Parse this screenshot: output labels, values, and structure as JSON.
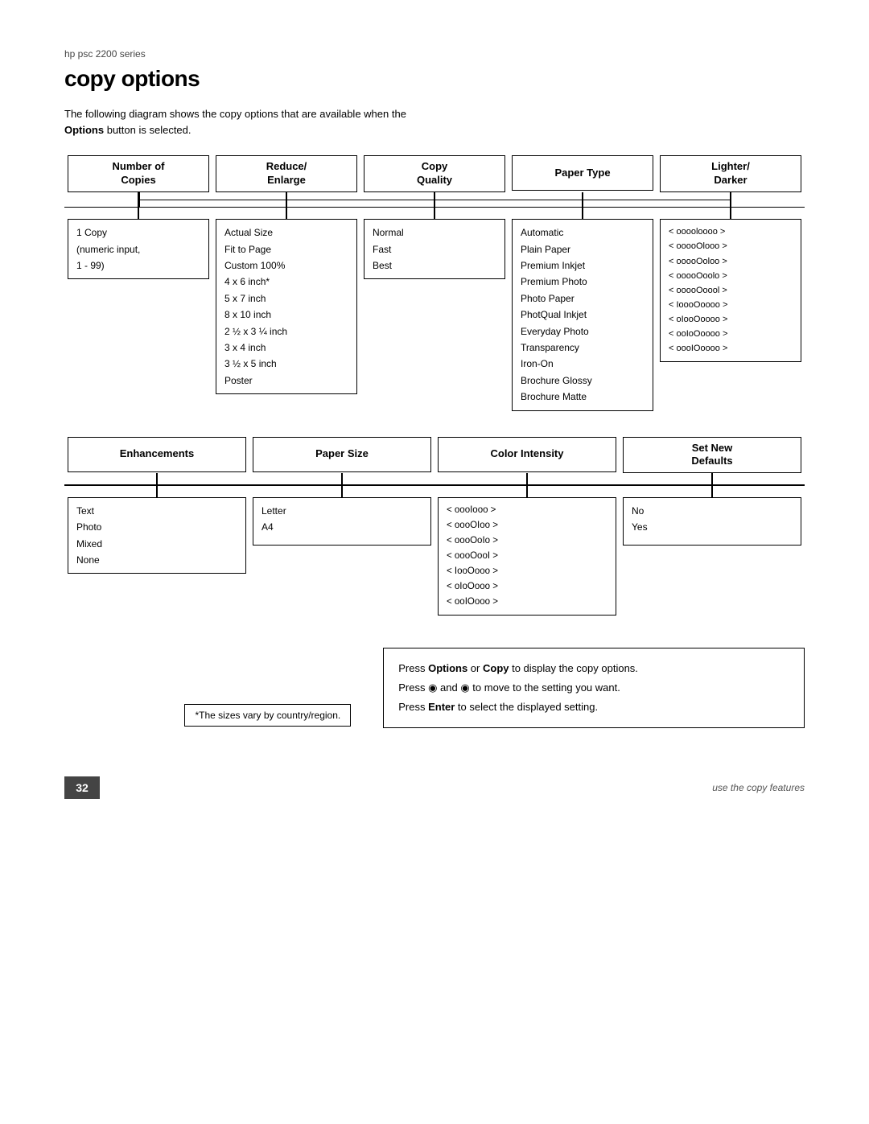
{
  "series": "hp psc 2200 series",
  "title": "copy options",
  "intro": {
    "line1": "The following diagram shows the copy options that are available when the",
    "line2_bold": "Options",
    "line2_rest": " button is selected."
  },
  "row1": {
    "connector_line_height": 18,
    "columns": [
      {
        "id": "number-of-copies",
        "header": "Number of\nCopies",
        "content": "1 Copy\n(numeric input,\n1 - 99)"
      },
      {
        "id": "reduce-enlarge",
        "header": "Reduce/\nEnlarge",
        "content": "Actual Size\nFit to Page\nCustom 100%\n4 x 6 inch*\n5 x 7 inch\n8 x 10 inch\n2 ½ x 3 ¼ inch\n3 x 4 inch\n3 ½ x 5 inch\nPoster"
      },
      {
        "id": "copy-quality",
        "header": "Copy\nQuality",
        "content": "Normal\nFast\nBest"
      },
      {
        "id": "paper-type",
        "header": "Paper Type",
        "content": "Automatic\nPlain Paper\nPremium Inkjet\nPremium Photo\nPhoto Paper\nPhotQual Inkjet\nEveryday Photo\nTransparency\nIron-On\nBrochure Glossy\nBrochure Matte"
      },
      {
        "id": "lighter-darker",
        "header": "Lighter/\nDarker",
        "content": "< ooooloooo >\n< ooooOlooo >\n< ooooOoloo >\n< ooooOoolo >\n< ooooOoool >\n< IoooOoooo >\n< oIooOoooo >\n< ooIoOoooo >\n< oooIOoooo >"
      }
    ]
  },
  "row2": {
    "columns": [
      {
        "id": "enhancements",
        "header": "Enhancements",
        "content": "Text\nPhoto\nMixed\nNone"
      },
      {
        "id": "paper-size",
        "header": "Paper Size",
        "content": "Letter\nA4"
      },
      {
        "id": "color-intensity",
        "header": "Color Intensity",
        "content": "< oooIooo >\n< oooOIoo >\n< oooOoIo >\n< oooOooI >\n< IooOooo >\n< oIoOooo >\n< ooIOooo >"
      },
      {
        "id": "set-new-defaults",
        "header": "Set New\nDefaults",
        "content": "No\nYes"
      }
    ]
  },
  "footnote": "*The sizes vary by country/region.",
  "info_box": {
    "line1_pre": "Press ",
    "line1_bold1": "Options",
    "line1_mid": " or ",
    "line1_bold2": "Copy",
    "line1_post": " to display the copy",
    "line2": "options.",
    "line3_pre": "Press ",
    "line3_icon1": "◉",
    "line3_mid": " and ",
    "line3_icon2": "◉",
    "line3_post": " to move to the setting you want.",
    "line4_pre": "Press ",
    "line4_bold": "Enter",
    "line4_post": " to select the displayed setting."
  },
  "footer": {
    "page_number": "32",
    "footer_text": "use the copy features"
  }
}
